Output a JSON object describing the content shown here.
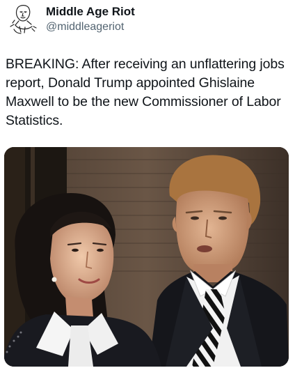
{
  "post": {
    "author": {
      "display_name": "Middle Age Riot",
      "handle": "@middleageriot",
      "avatar_icon": "sketch-portrait-avatar"
    },
    "text": "BREAKING: After receiving an unflattering jobs report, Donald Trump appointed Ghislaine Maxwell to be the new Commissioner of Labor Statistics.",
    "media": {
      "type": "photo",
      "content": "two people standing in front of a brick wall: a woman with dark hair in a white collared shirt and a man in a dark suit with a striped tie"
    }
  },
  "colors": {
    "text_primary": "#0f1419",
    "text_secondary": "#536471",
    "background": "#ffffff"
  }
}
